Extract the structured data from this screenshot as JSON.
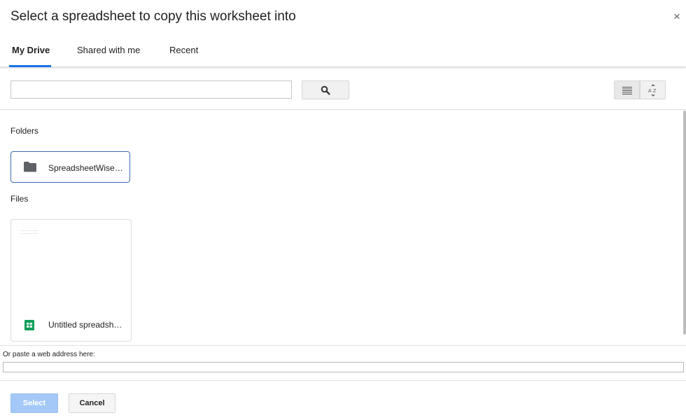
{
  "dialog": {
    "title": "Select a spreadsheet to copy this worksheet into",
    "close_label": "×"
  },
  "tabs": [
    {
      "label": "My Drive",
      "active": true
    },
    {
      "label": "Shared with me",
      "active": false
    },
    {
      "label": "Recent",
      "active": false
    }
  ],
  "search": {
    "value": "",
    "button_icon": "search-icon"
  },
  "view_controls": {
    "list_icon": "list-view-icon",
    "sort_icon": "sort-az-icon"
  },
  "sections": {
    "folders_label": "Folders",
    "files_label": "Files"
  },
  "folders": [
    {
      "name": "SpreadsheetWise…",
      "icon": "folder-icon"
    }
  ],
  "files": [
    {
      "name": "Untitled spreadsh…",
      "icon": "google-sheets-icon"
    }
  ],
  "paste": {
    "label": "Or paste a web address here:",
    "value": ""
  },
  "footer": {
    "select_label": "Select",
    "cancel_label": "Cancel"
  },
  "colors": {
    "accent": "#1a73e8",
    "folder_border": "#3c6fb4",
    "select_button_disabled": "#a4c8f7",
    "sheets_green": "#0f9d58"
  }
}
